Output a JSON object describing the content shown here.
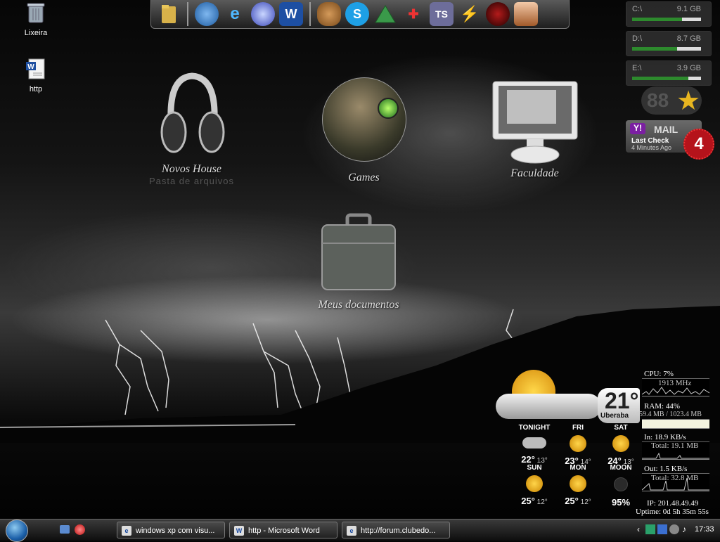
{
  "desktop_icons": [
    {
      "label": "Lixeira",
      "icon": "recycle-bin-icon"
    },
    {
      "label": "http",
      "icon": "word-document-icon"
    }
  ],
  "big_icons": {
    "novos_house": {
      "label": "Novos House",
      "sublabel": "Pasta de arquivos"
    },
    "games": {
      "label": "Games"
    },
    "faculdade": {
      "label": "Faculdade"
    },
    "meus_documentos": {
      "label": "Meus documentos"
    }
  },
  "dock": {
    "icons": [
      "folder-icon",
      "network-globe-icon",
      "internet-explorer-icon",
      "browser-globe-icon",
      "word-icon",
      "donkey-icon",
      "skype-icon",
      "pyramid-icon",
      "mascot-icon",
      "ts-icon",
      "winamp-icon",
      "media-disc-icon",
      "anime-avatar-icon"
    ],
    "ts_label": "TS"
  },
  "drives": [
    {
      "letter": "C:\\",
      "size": "9.1 GB",
      "used_fraction": 0.72
    },
    {
      "letter": "D:\\",
      "size": "8.7 GB",
      "used_fraction": 0.65
    },
    {
      "letter": "E:\\",
      "size": "3.9 GB",
      "used_fraction": 0.82
    }
  ],
  "clock_widget": {
    "value": "88"
  },
  "mail": {
    "provider_mark": "Y!",
    "label": "MAIL",
    "last_check": "Last Check",
    "ago": "4 Minutes Ago",
    "count": "4"
  },
  "weather": {
    "temp": "21°",
    "city": "Uberaba",
    "days": [
      {
        "name": "TONIGHT",
        "hi": "22°",
        "lo": "13°",
        "icon": "cloudy-moon-icon"
      },
      {
        "name": "FRI",
        "hi": "23°",
        "lo": "14°",
        "icon": "sun-icon"
      },
      {
        "name": "SAT",
        "hi": "24°",
        "lo": "13°",
        "icon": "sun-icon"
      },
      {
        "name": "SUN",
        "hi": "25°",
        "lo": "12°",
        "icon": "sun-icon"
      },
      {
        "name": "MON",
        "hi": "25°",
        "lo": "12°",
        "icon": "sun-icon"
      },
      {
        "name": "MOON",
        "hi": "95%",
        "lo": "",
        "icon": "moon-icon"
      }
    ]
  },
  "sysmon": {
    "cpu": "CPU: 7%",
    "cpu_mhz": "1913 MHz",
    "ram": "RAM: 44%",
    "ram_detail": "459.4 MB / 1023.4 MB",
    "net_in": "In: 18.9 KB/s",
    "net_in_total": "Total: 19.1 MB",
    "net_out": "Out: 1.5 KB/s",
    "net_out_total": "Total: 32.8 MB",
    "ip": "IP: 201.48.49.49",
    "uptime": "Uptime: 0d 5h 35m 55s"
  },
  "taskbar": {
    "tasks": [
      {
        "label": "windows xp com visu...",
        "icon": "ie-task-icon"
      },
      {
        "label": "http - Microsoft Word",
        "icon": "word-task-icon",
        "mark": "W"
      },
      {
        "label": "http://forum.clubedo...",
        "icon": "ie-task-icon"
      }
    ],
    "clock": "17:33"
  }
}
